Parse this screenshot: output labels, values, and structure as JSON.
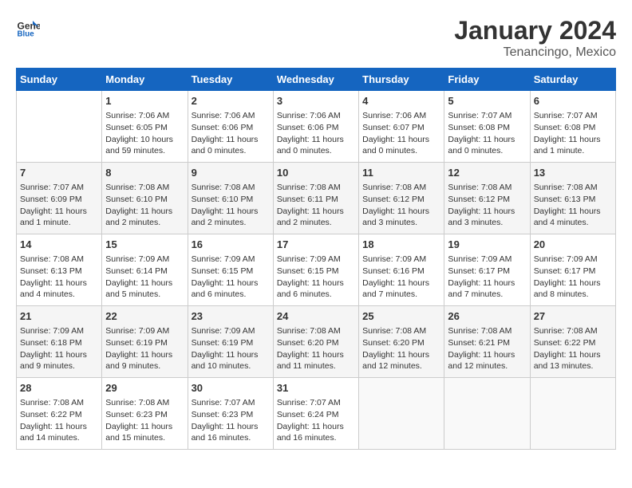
{
  "header": {
    "logo_general": "General",
    "logo_blue": "Blue",
    "month": "January 2024",
    "location": "Tenancingo, Mexico"
  },
  "weekdays": [
    "Sunday",
    "Monday",
    "Tuesday",
    "Wednesday",
    "Thursday",
    "Friday",
    "Saturday"
  ],
  "weeks": [
    [
      {
        "day": null,
        "info": ""
      },
      {
        "day": "1",
        "info": "Sunrise: 7:06 AM\nSunset: 6:05 PM\nDaylight: 10 hours\nand 59 minutes."
      },
      {
        "day": "2",
        "info": "Sunrise: 7:06 AM\nSunset: 6:06 PM\nDaylight: 11 hours\nand 0 minutes."
      },
      {
        "day": "3",
        "info": "Sunrise: 7:06 AM\nSunset: 6:06 PM\nDaylight: 11 hours\nand 0 minutes."
      },
      {
        "day": "4",
        "info": "Sunrise: 7:06 AM\nSunset: 6:07 PM\nDaylight: 11 hours\nand 0 minutes."
      },
      {
        "day": "5",
        "info": "Sunrise: 7:07 AM\nSunset: 6:08 PM\nDaylight: 11 hours\nand 0 minutes."
      },
      {
        "day": "6",
        "info": "Sunrise: 7:07 AM\nSunset: 6:08 PM\nDaylight: 11 hours\nand 1 minute."
      }
    ],
    [
      {
        "day": "7",
        "info": "Sunrise: 7:07 AM\nSunset: 6:09 PM\nDaylight: 11 hours\nand 1 minute."
      },
      {
        "day": "8",
        "info": "Sunrise: 7:08 AM\nSunset: 6:10 PM\nDaylight: 11 hours\nand 2 minutes."
      },
      {
        "day": "9",
        "info": "Sunrise: 7:08 AM\nSunset: 6:10 PM\nDaylight: 11 hours\nand 2 minutes."
      },
      {
        "day": "10",
        "info": "Sunrise: 7:08 AM\nSunset: 6:11 PM\nDaylight: 11 hours\nand 2 minutes."
      },
      {
        "day": "11",
        "info": "Sunrise: 7:08 AM\nSunset: 6:12 PM\nDaylight: 11 hours\nand 3 minutes."
      },
      {
        "day": "12",
        "info": "Sunrise: 7:08 AM\nSunset: 6:12 PM\nDaylight: 11 hours\nand 3 minutes."
      },
      {
        "day": "13",
        "info": "Sunrise: 7:08 AM\nSunset: 6:13 PM\nDaylight: 11 hours\nand 4 minutes."
      }
    ],
    [
      {
        "day": "14",
        "info": "Sunrise: 7:08 AM\nSunset: 6:13 PM\nDaylight: 11 hours\nand 4 minutes."
      },
      {
        "day": "15",
        "info": "Sunrise: 7:09 AM\nSunset: 6:14 PM\nDaylight: 11 hours\nand 5 minutes."
      },
      {
        "day": "16",
        "info": "Sunrise: 7:09 AM\nSunset: 6:15 PM\nDaylight: 11 hours\nand 6 minutes."
      },
      {
        "day": "17",
        "info": "Sunrise: 7:09 AM\nSunset: 6:15 PM\nDaylight: 11 hours\nand 6 minutes."
      },
      {
        "day": "18",
        "info": "Sunrise: 7:09 AM\nSunset: 6:16 PM\nDaylight: 11 hours\nand 7 minutes."
      },
      {
        "day": "19",
        "info": "Sunrise: 7:09 AM\nSunset: 6:17 PM\nDaylight: 11 hours\nand 7 minutes."
      },
      {
        "day": "20",
        "info": "Sunrise: 7:09 AM\nSunset: 6:17 PM\nDaylight: 11 hours\nand 8 minutes."
      }
    ],
    [
      {
        "day": "21",
        "info": "Sunrise: 7:09 AM\nSunset: 6:18 PM\nDaylight: 11 hours\nand 9 minutes."
      },
      {
        "day": "22",
        "info": "Sunrise: 7:09 AM\nSunset: 6:19 PM\nDaylight: 11 hours\nand 9 minutes."
      },
      {
        "day": "23",
        "info": "Sunrise: 7:09 AM\nSunset: 6:19 PM\nDaylight: 11 hours\nand 10 minutes."
      },
      {
        "day": "24",
        "info": "Sunrise: 7:08 AM\nSunset: 6:20 PM\nDaylight: 11 hours\nand 11 minutes."
      },
      {
        "day": "25",
        "info": "Sunrise: 7:08 AM\nSunset: 6:20 PM\nDaylight: 11 hours\nand 12 minutes."
      },
      {
        "day": "26",
        "info": "Sunrise: 7:08 AM\nSunset: 6:21 PM\nDaylight: 11 hours\nand 12 minutes."
      },
      {
        "day": "27",
        "info": "Sunrise: 7:08 AM\nSunset: 6:22 PM\nDaylight: 11 hours\nand 13 minutes."
      }
    ],
    [
      {
        "day": "28",
        "info": "Sunrise: 7:08 AM\nSunset: 6:22 PM\nDaylight: 11 hours\nand 14 minutes."
      },
      {
        "day": "29",
        "info": "Sunrise: 7:08 AM\nSunset: 6:23 PM\nDaylight: 11 hours\nand 15 minutes."
      },
      {
        "day": "30",
        "info": "Sunrise: 7:07 AM\nSunset: 6:23 PM\nDaylight: 11 hours\nand 16 minutes."
      },
      {
        "day": "31",
        "info": "Sunrise: 7:07 AM\nSunset: 6:24 PM\nDaylight: 11 hours\nand 16 minutes."
      },
      {
        "day": null,
        "info": ""
      },
      {
        "day": null,
        "info": ""
      },
      {
        "day": null,
        "info": ""
      }
    ]
  ]
}
